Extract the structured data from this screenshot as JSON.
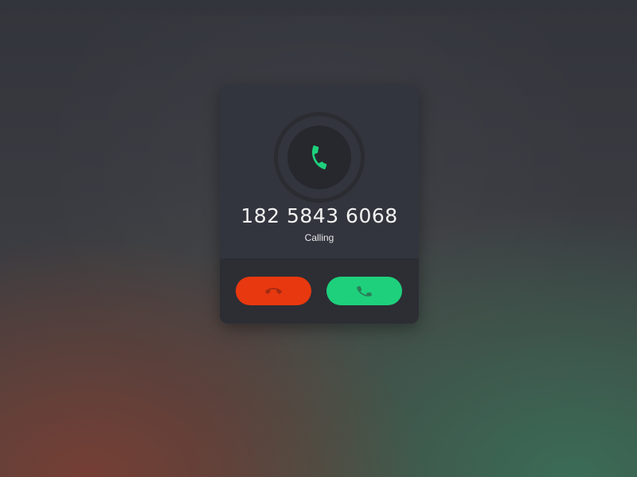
{
  "call": {
    "phone_number": "182 5843 6068",
    "status": "Calling"
  },
  "icons": {
    "avatar": "phone-icon",
    "decline": "hang-up-icon",
    "accept": "phone-icon"
  },
  "colors": {
    "decline": "#e8380f",
    "accept": "#1ed07c",
    "avatar_glyph": "#1ed07c",
    "button_glyph": "#2a7e58"
  }
}
